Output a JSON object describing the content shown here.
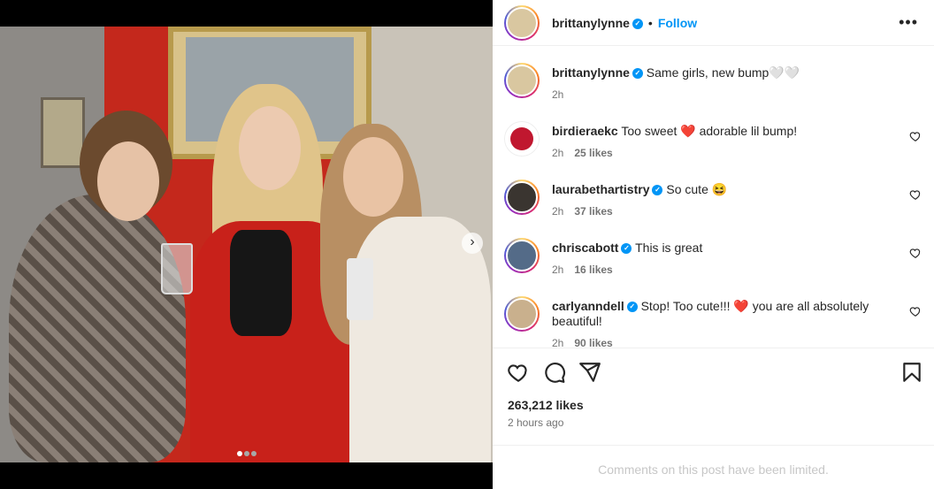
{
  "post": {
    "username": "brittanylynne",
    "follow_label": "Follow",
    "separator": "•",
    "more_label": "•••",
    "caption_text": "Same girls, new bump🤍🤍",
    "caption_time": "2h",
    "carousel_next": "›",
    "slides_count": 3,
    "active_slide": 1
  },
  "comments": [
    {
      "username": "birdieraekc",
      "text": "Too sweet ❤️ adorable lil bump!",
      "time": "2h",
      "likes": "25 likes"
    },
    {
      "username": "laurabethartistry",
      "text": "So cute 😆",
      "time": "2h",
      "likes": "37 likes"
    },
    {
      "username": "chriscabott",
      "text": "This is great",
      "time": "2h",
      "likes": "16 likes"
    },
    {
      "username": "carlyanndell",
      "text": "Stop! Too cute!!! ❤️ you are all absolutely beautiful!",
      "time": "2h",
      "likes": "90 likes"
    }
  ],
  "actions": {
    "like_icon": "heart-icon",
    "comment_icon": "comment-icon",
    "share_icon": "share-icon",
    "save_icon": "bookmark-icon"
  },
  "stats": {
    "likes": "263,212 likes",
    "posted": "2 hours ago"
  },
  "footer": {
    "limited": "Comments on this post have been limited."
  },
  "colors": {
    "accent": "#0095f6",
    "secondary_text": "#737373",
    "red_heart": "#ed4956"
  }
}
